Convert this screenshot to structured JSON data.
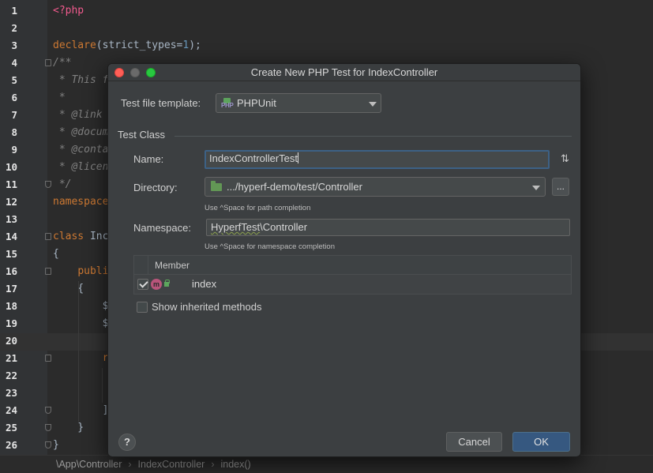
{
  "editor": {
    "lines": [
      {
        "n": "1",
        "html": "<span class='tag'>&lt;?php</span>"
      },
      {
        "n": "2",
        "html": ""
      },
      {
        "n": "3",
        "html": "<span class='kw'>declare</span>(strict_types=<span class='num'>1</span>);"
      },
      {
        "n": "4",
        "html": "<span class='cm'>/**</span>"
      },
      {
        "n": "5",
        "html": "<span class='cm'> * This f</span>"
      },
      {
        "n": "6",
        "html": "<span class='cm'> *</span>"
      },
      {
        "n": "7",
        "html": "<span class='cm'> * @link</span>"
      },
      {
        "n": "8",
        "html": "<span class='cm'> * @docum</span>"
      },
      {
        "n": "9",
        "html": "<span class='cm'> * @conta</span>"
      },
      {
        "n": "10",
        "html": "<span class='cm'> * @licen</span>"
      },
      {
        "n": "11",
        "html": "<span class='cm'> */</span>"
      },
      {
        "n": "12",
        "html": "<span class='kw'>namespace</span>"
      },
      {
        "n": "13",
        "html": ""
      },
      {
        "n": "14",
        "html": "<span class='kw'>class</span> Inc"
      },
      {
        "n": "15",
        "html": "{"
      },
      {
        "n": "16",
        "html": "    <span class='kw'>publi</span>"
      },
      {
        "n": "17",
        "html": "    {"
      },
      {
        "n": "18",
        "html": "        $"
      },
      {
        "n": "19",
        "html": "        $"
      },
      {
        "n": "20",
        "html": ""
      },
      {
        "n": "21",
        "html": "        <span class='kw'>r</span>"
      },
      {
        "n": "22",
        "html": ""
      },
      {
        "n": "23",
        "html": ""
      },
      {
        "n": "24",
        "html": "        ]"
      },
      {
        "n": "25",
        "html": "    }"
      },
      {
        "n": "26",
        "html": "}"
      }
    ],
    "current_line": "20"
  },
  "breadcrumbs": [
    "\\App\\Controller",
    "IndexController",
    "index()"
  ],
  "dialog": {
    "title": "Create New PHP Test for IndexController",
    "template_label": "Test file template:",
    "template_value": "PHPUnit",
    "template_icon_text": "PHP",
    "section_title": "Test Class",
    "name_label": "Name:",
    "name_value": "IndexControllerTest",
    "sort_icon": "⇅",
    "directory_label": "Directory:",
    "directory_value": ".../hyperf-demo/test/Controller",
    "browse_label": "...",
    "directory_hint": "Use ^Space for path completion",
    "namespace_label": "Namespace:",
    "namespace_value_a": "HyperfTest",
    "namespace_value_b": "\\Controller",
    "namespace_hint": "Use ^Space for namespace completion",
    "table_header": "Member",
    "members": [
      {
        "icon_text": "m",
        "name": "index",
        "checked": true
      }
    ],
    "show_inherited_label": "Show inherited methods",
    "help_label": "?",
    "cancel_label": "Cancel",
    "ok_label": "OK"
  }
}
